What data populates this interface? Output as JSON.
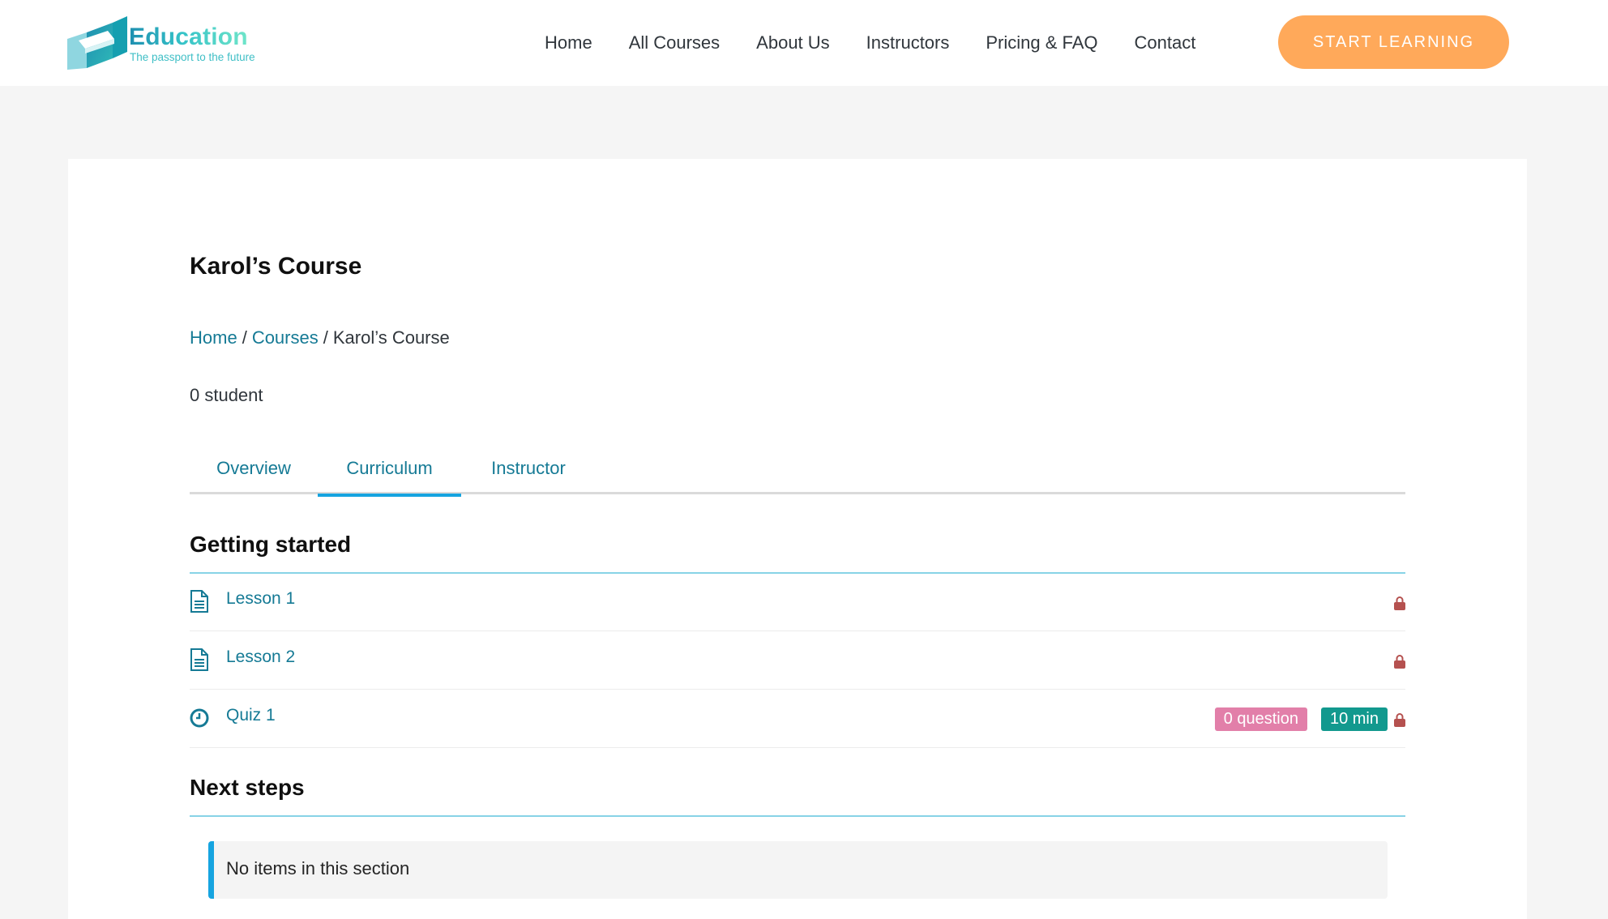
{
  "brand": {
    "title": "Education",
    "tagline": "The passport to the future"
  },
  "nav": {
    "items": [
      "Home",
      "All Courses",
      "About Us",
      "Instructors",
      "Pricing & FAQ",
      "Contact"
    ],
    "cta": "START LEARNING"
  },
  "course": {
    "title": "Karol’s Course",
    "breadcrumb": {
      "home": "Home",
      "courses": "Courses",
      "current": "Karol’s Course",
      "separator": "/"
    },
    "student_count": "0 student"
  },
  "tabs": [
    {
      "label": "Overview",
      "active": false
    },
    {
      "label": "Curriculum",
      "active": true
    },
    {
      "label": "Instructor",
      "active": false
    }
  ],
  "curriculum": {
    "sections": [
      {
        "title": "Getting started",
        "items": [
          {
            "type": "lesson",
            "icon": "document-icon",
            "title": "Lesson 1",
            "locked": true
          },
          {
            "type": "lesson",
            "icon": "document-icon",
            "title": "Lesson 2",
            "locked": true
          },
          {
            "type": "quiz",
            "icon": "clock-icon",
            "title": "Quiz 1",
            "questions": "0 question",
            "duration": "10 min",
            "locked": true
          }
        ]
      },
      {
        "title": "Next steps",
        "empty_message": "No items in this section"
      }
    ]
  },
  "colors": {
    "accent": "#157a95",
    "cta": "#ffa95a",
    "tab_underline": "#16a4e0",
    "lock": "#b5514f",
    "badge_questions": "#e27fa9",
    "badge_duration": "#12998e"
  }
}
